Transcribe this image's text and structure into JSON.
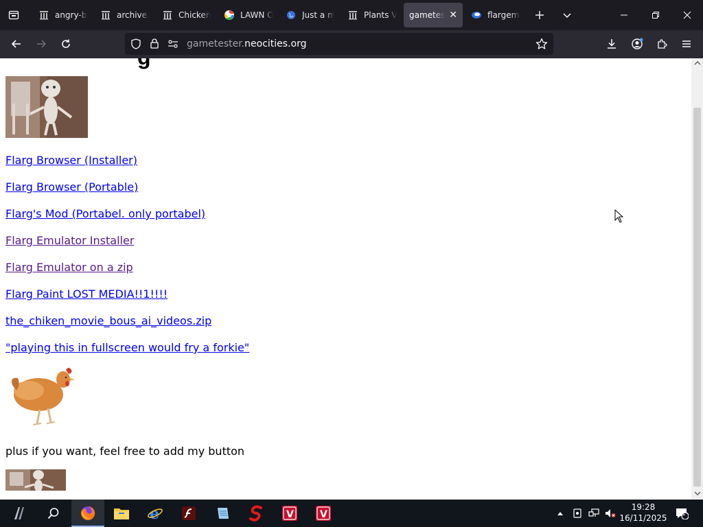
{
  "browser": {
    "tabs": [
      {
        "title": "angry-bi",
        "favicon": "archive-icon"
      },
      {
        "title": "archive.o",
        "favicon": "archive-icon"
      },
      {
        "title": "Chicken",
        "favicon": "archive-icon"
      },
      {
        "title": "LAWN O",
        "favicon": "google-icon"
      },
      {
        "title": "Just a mo",
        "favicon": "globe-icon"
      },
      {
        "title": "Plants VS",
        "favicon": "archive-icon"
      },
      {
        "title": "gameteste",
        "favicon": "none",
        "active": true
      },
      {
        "title": "flargemu",
        "favicon": "flarg-icon"
      }
    ],
    "url": {
      "host_prefix": "gametester.",
      "host_main": "neocities.org"
    },
    "accent": "#42414d"
  },
  "page": {
    "heading_fragment": "g",
    "links": [
      {
        "text": "Flarg Browser (Installer)",
        "visited": false
      },
      {
        "text": "Flarg Browser (Portable)",
        "visited": false
      },
      {
        "text": "Flarg's Mod (Portabel. only portabel)",
        "visited": false
      },
      {
        "text": "Flarg Emulator Installer",
        "visited": true
      },
      {
        "text": "Flarg Emulator on a zip",
        "visited": true
      },
      {
        "text": "Flarg Paint LOST MEDIA!!1!!!!",
        "visited": false
      },
      {
        "text": "the_chiken_movie_bous_ai_videos.zip",
        "visited": false
      },
      {
        "text": "\"playing this in fullscreen would fry a forkie\"",
        "visited": false
      }
    ],
    "plain_text": "plus if you want, feel free to add my button",
    "link_color": "#0000ee",
    "visited_color": "#551a8b"
  },
  "taskbar": {
    "apps": [
      "start-icon",
      "search-icon",
      "firefox-icon",
      "file-explorer-icon",
      "internet-explorer-icon",
      "flash-icon",
      "notepad-icon",
      "red-s-icon",
      "red-app-icon",
      "red-app-icon-2"
    ],
    "clock": {
      "time": "19:28",
      "date": "16/11/2025"
    },
    "notification_count": "1"
  }
}
